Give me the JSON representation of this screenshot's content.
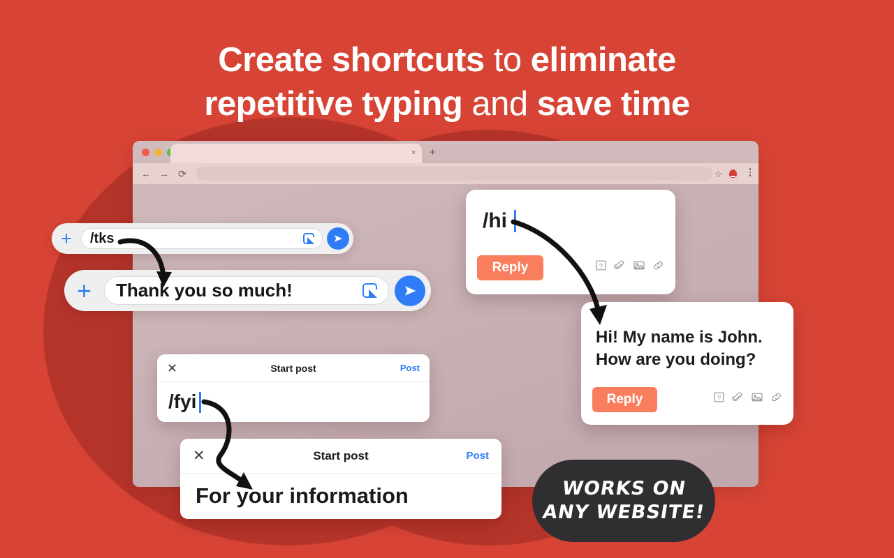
{
  "theme": {
    "background": "#d74435",
    "blob": "#b5342a",
    "accent_blue": "#2f7df6",
    "accent_orange": "#f97e5e",
    "badge_dark": "#2f2f31"
  },
  "headline": {
    "line1_a": "Create shortcuts",
    "line1_b": "to",
    "line1_c": "eliminate",
    "line2_a": "repetitive typing",
    "line2_b": "and",
    "line2_c": "save time"
  },
  "browser": {
    "tab_close": "×",
    "tab_new": "+",
    "back": "←",
    "forward": "→",
    "reload": "⟳",
    "bookmark_star": "☆",
    "url_value": "",
    "url_placeholder": ""
  },
  "compose_small": {
    "plus": "+",
    "text": "/tks",
    "sticker_icon": "sticker-icon",
    "send_icon": "send-icon"
  },
  "compose_large": {
    "plus": "+",
    "text": "Thank you so much!",
    "sticker_icon": "sticker-icon",
    "send_icon": "send-icon"
  },
  "card_shortcut": {
    "text": "/hi",
    "reply_label": "Reply",
    "icons": [
      "help-icon",
      "paperclip-icon",
      "image-icon",
      "link-icon"
    ]
  },
  "card_expanded": {
    "line1": "Hi! My name is John.",
    "line2": "How are you doing?",
    "reply_label": "Reply",
    "icons": [
      "help-icon",
      "paperclip-icon",
      "image-icon",
      "link-icon"
    ]
  },
  "post_shortcut": {
    "close": "✕",
    "title": "Start post",
    "action": "Post",
    "text": "/fyi"
  },
  "post_expanded": {
    "close": "✕",
    "title": "Start post",
    "action": "Post",
    "text": "For your information"
  },
  "badge": {
    "line1": "Works on",
    "line2": "any website!"
  }
}
